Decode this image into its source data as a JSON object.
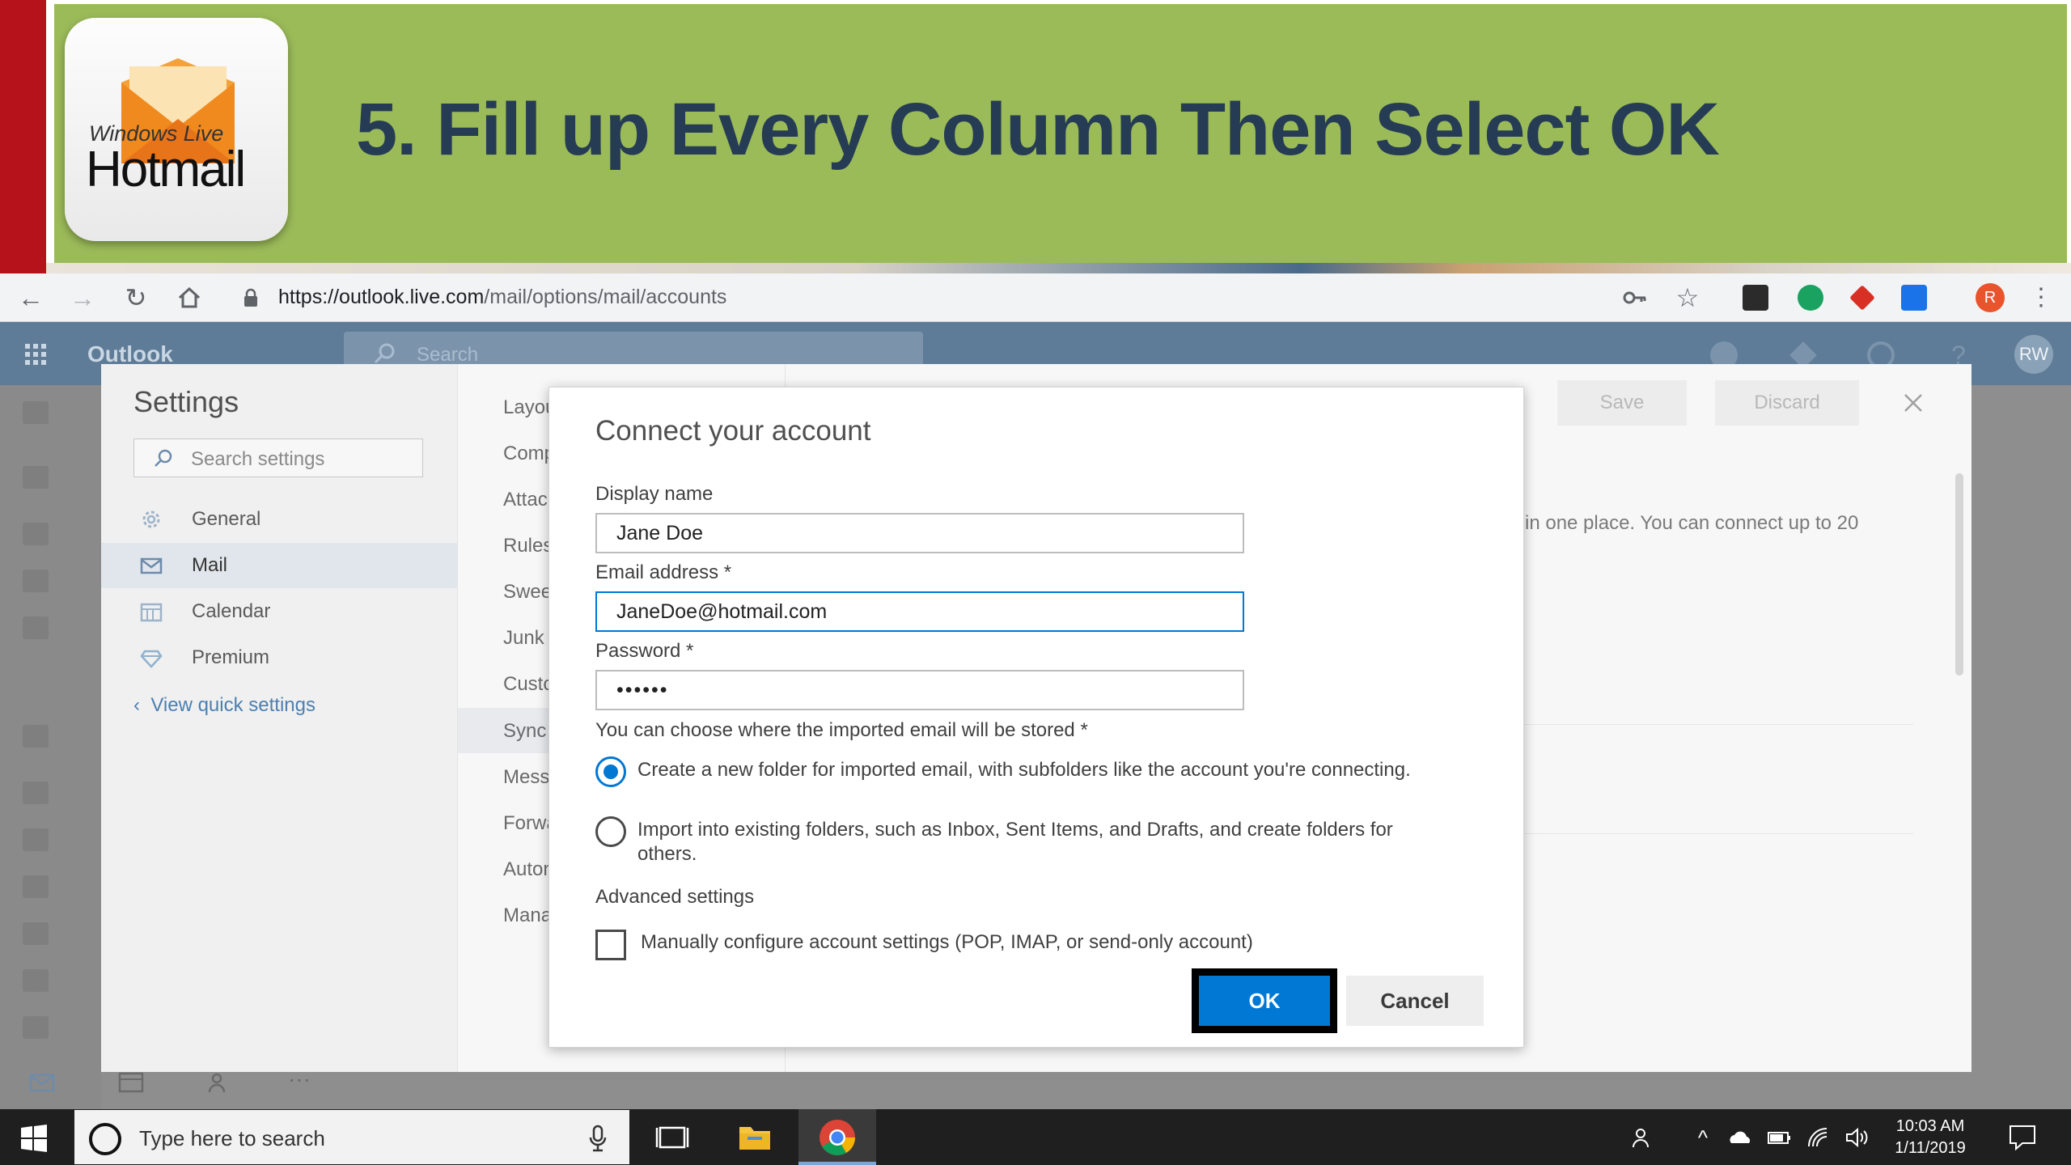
{
  "banner": {
    "logo_sub": "Windows Live",
    "logo_main": "Hotmail",
    "title": "5. Fill up Every Column Then Select OK"
  },
  "browser": {
    "url_host": "https://outlook.live.com",
    "url_path": "/mail/options/mail/accounts",
    "profile_initial": "R"
  },
  "outlook": {
    "brand": "Outlook",
    "search_placeholder": "Search",
    "avatar": "RW"
  },
  "settings": {
    "title": "Settings",
    "search_placeholder": "Search settings",
    "nav": [
      {
        "label": "General",
        "icon": "gear-icon"
      },
      {
        "label": "Mail",
        "icon": "mail-icon"
      },
      {
        "label": "Calendar",
        "icon": "calendar-icon"
      },
      {
        "label": "Premium",
        "icon": "diamond-icon"
      }
    ],
    "view_quick": "View quick settings",
    "mid_items": [
      "Layou",
      "Comp",
      "Attacl",
      "Rules",
      "Sweep",
      "Junk e",
      "Custo",
      "Sync e",
      "Messa",
      "Forwa",
      "Auton",
      "Mana"
    ],
    "save": "Save",
    "discard": "Discard",
    "right_text": "in one place. You can connect up to 20"
  },
  "dialog": {
    "title": "Connect your account",
    "display_name_label": "Display name",
    "display_name_value": "Jane Doe",
    "email_label": "Email address *",
    "email_value": "JaneDoe@hotmail.com",
    "password_label": "Password *",
    "password_value": "••••••",
    "storage_label": "You can choose where the imported email will be stored *",
    "radio_new": "Create a new folder for imported email, with subfolders like the account you're connecting.",
    "radio_existing": "Import into existing folders, such as Inbox, Sent Items, and Drafts, and create folders for others.",
    "advanced_label": "Advanced settings",
    "manual_config": "Manually configure account settings (POP, IMAP, or send-only account)",
    "ok": "OK",
    "cancel": "Cancel"
  },
  "taskbar": {
    "search_placeholder": "Type here to search",
    "time": "10:03 AM",
    "date": "1/11/2019"
  }
}
